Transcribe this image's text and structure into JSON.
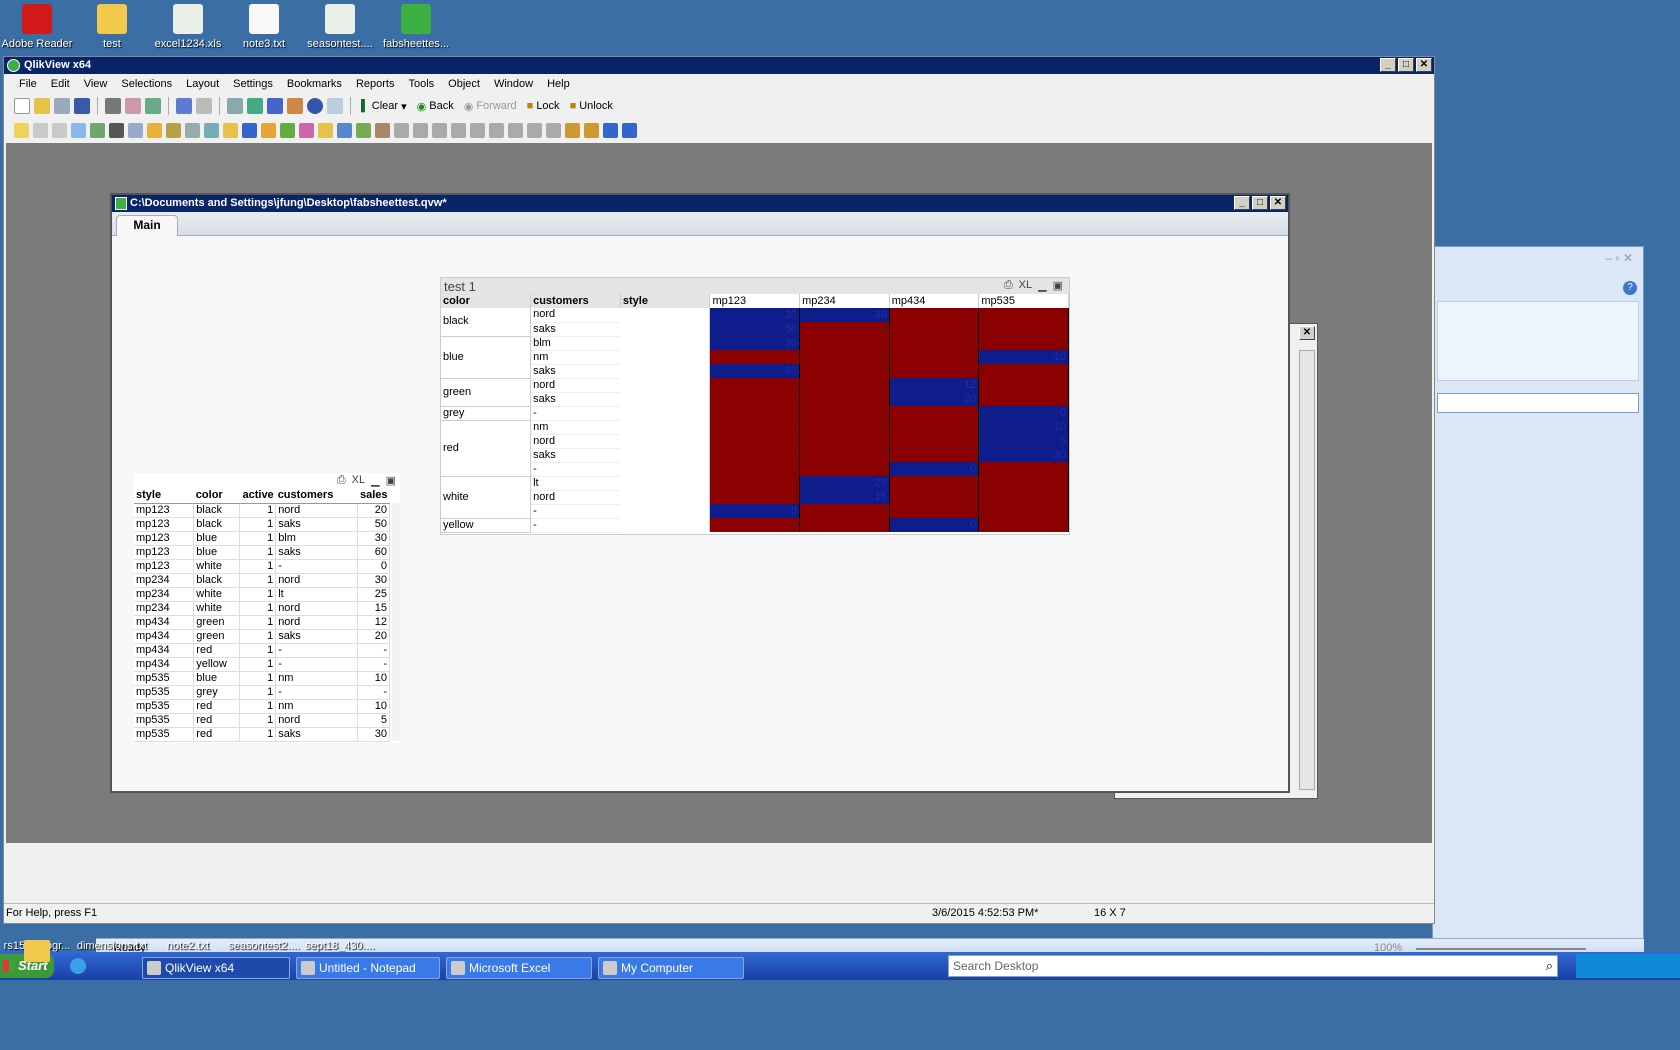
{
  "desktop_top": [
    {
      "label": "Adobe Reader",
      "icon": "adobe-reader-icon",
      "color": "#d21a1a"
    },
    {
      "label": "test",
      "icon": "folder-icon",
      "color": "#f2c94c"
    },
    {
      "label": "excel1234.xls",
      "icon": "excel-file-icon",
      "color": "#e8f0e8"
    },
    {
      "label": "note3.txt",
      "icon": "text-file-icon",
      "color": "#f8f8f8"
    },
    {
      "label": "seasontest....",
      "icon": "excel-file-icon",
      "color": "#e8f0e8"
    },
    {
      "label": "fabsheettes...",
      "icon": "qlikview-file-icon",
      "color": "#3cb043"
    }
  ],
  "desktop_bottom": [
    {
      "label": "rs15planogr...",
      "icon": "folder-icon"
    },
    {
      "label": "dimensions.txt",
      "icon": "text-file-icon"
    },
    {
      "label": "note2.txt",
      "icon": "text-file-icon"
    },
    {
      "label": "seasontest2....",
      "icon": "excel-file-icon"
    },
    {
      "label": "sept18_430....",
      "icon": "excel-file-icon"
    }
  ],
  "app": {
    "title": "QlikView x64",
    "menu": [
      "File",
      "Edit",
      "View",
      "Selections",
      "Layout",
      "Settings",
      "Bookmarks",
      "Reports",
      "Tools",
      "Object",
      "Window",
      "Help"
    ],
    "toolbar": {
      "clear": "Clear",
      "back": "Back",
      "forward": "Forward",
      "lock": "Lock",
      "unlock": "Unlock"
    },
    "status": {
      "help": "For Help, press F1",
      "datetime": "3/6/2015 4:52:53 PM*",
      "dims": "16 X 7"
    }
  },
  "doc": {
    "title": "C:\\Documents and Settings\\jfung\\Desktop\\fabsheettest.qvw*",
    "tab": "Main"
  },
  "pivot": {
    "title": "test 1",
    "xl": "XL",
    "headers": [
      "color",
      "customers",
      "style"
    ],
    "columns": [
      "mp123",
      "mp234",
      "mp434",
      "mp535"
    ],
    "colors": {
      "red": "#8b0000",
      "blue": "#0f1c8c"
    },
    "groups": [
      {
        "color": "black",
        "rows": [
          {
            "c": "nord",
            "v": [
              "20",
              "30",
              "0",
              "0"
            ],
            "k": "bbrr"
          },
          {
            "c": "saks",
            "v": [
              "50",
              "0",
              "0",
              "0"
            ],
            "k": "brrr"
          }
        ]
      },
      {
        "color": "blue",
        "rows": [
          {
            "c": "blm",
            "v": [
              "30",
              "0",
              "0",
              "0"
            ],
            "k": "brrr"
          },
          {
            "c": "nm",
            "v": [
              "0",
              "0",
              "0",
              "10"
            ],
            "k": "rrrb"
          },
          {
            "c": "saks",
            "v": [
              "60",
              "0",
              "0",
              "0"
            ],
            "k": "brrr"
          }
        ]
      },
      {
        "color": "green",
        "rows": [
          {
            "c": "nord",
            "v": [
              "0",
              "0",
              "12",
              "0"
            ],
            "k": "rrbr"
          },
          {
            "c": "saks",
            "v": [
              "0",
              "0",
              "20",
              "0"
            ],
            "k": "rrbr"
          }
        ]
      },
      {
        "color": "grey",
        "rows": [
          {
            "c": "-",
            "v": [
              "0",
              "0",
              "0",
              "0"
            ],
            "k": "rrrb"
          }
        ]
      },
      {
        "color": "red",
        "rows": [
          {
            "c": "nm",
            "v": [
              "0",
              "0",
              "0",
              "10"
            ],
            "k": "rrrb"
          },
          {
            "c": "nord",
            "v": [
              "0",
              "0",
              "0",
              "5"
            ],
            "k": "rrrb"
          },
          {
            "c": "saks",
            "v": [
              "0",
              "0",
              "0",
              "30"
            ],
            "k": "rrrb"
          },
          {
            "c": "-",
            "v": [
              "0",
              "0",
              "0",
              "0"
            ],
            "k": "rrbr"
          }
        ]
      },
      {
        "color": "white",
        "rows": [
          {
            "c": "lt",
            "v": [
              "0",
              "25",
              "0",
              "0"
            ],
            "k": "rbrr"
          },
          {
            "c": "nord",
            "v": [
              "0",
              "15",
              "0",
              "0"
            ],
            "k": "rbrr"
          },
          {
            "c": "-",
            "v": [
              "0",
              "0",
              "0",
              "0"
            ],
            "k": "brrr"
          }
        ]
      },
      {
        "color": "yellow",
        "rows": [
          {
            "c": "-",
            "v": [
              "0",
              "0",
              "0",
              "0"
            ],
            "k": "rrbr"
          }
        ]
      }
    ]
  },
  "table": {
    "xl": "XL",
    "headers": [
      "style",
      "color",
      "active",
      "customers",
      "sales"
    ],
    "rows": [
      [
        "mp123",
        "black",
        "1",
        "nord",
        "20"
      ],
      [
        "mp123",
        "black",
        "1",
        "saks",
        "50"
      ],
      [
        "mp123",
        "blue",
        "1",
        "blm",
        "30"
      ],
      [
        "mp123",
        "blue",
        "1",
        "saks",
        "60"
      ],
      [
        "mp123",
        "white",
        "1",
        "-",
        "0"
      ],
      [
        "mp234",
        "black",
        "1",
        "nord",
        "30"
      ],
      [
        "mp234",
        "white",
        "1",
        "lt",
        "25"
      ],
      [
        "mp234",
        "white",
        "1",
        "nord",
        "15"
      ],
      [
        "mp434",
        "green",
        "1",
        "nord",
        "12"
      ],
      [
        "mp434",
        "green",
        "1",
        "saks",
        "20"
      ],
      [
        "mp434",
        "red",
        "1",
        "-",
        "-"
      ],
      [
        "mp434",
        "yellow",
        "1",
        "-",
        "-"
      ],
      [
        "mp535",
        "blue",
        "1",
        "nm",
        "10"
      ],
      [
        "mp535",
        "grey",
        "1",
        "-",
        "-"
      ],
      [
        "mp535",
        "red",
        "1",
        "nm",
        "10"
      ],
      [
        "mp535",
        "red",
        "1",
        "nord",
        "5"
      ],
      [
        "mp535",
        "red",
        "1",
        "saks",
        "30"
      ]
    ]
  },
  "excel": {
    "status": "Ready",
    "zoom": "100%"
  },
  "taskbar": {
    "start": "Start",
    "buttons": [
      "QlikView x64",
      "Untitled - Notepad",
      "Microsoft Excel",
      "My Computer"
    ],
    "search_placeholder": "Search Desktop"
  }
}
